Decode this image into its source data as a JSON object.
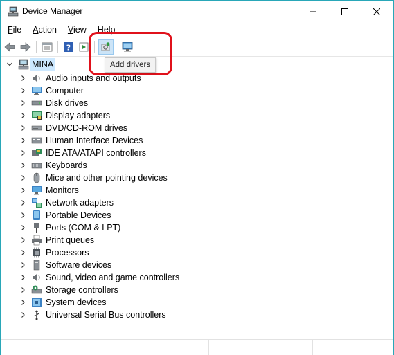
{
  "window": {
    "title": "Device Manager",
    "icon": "device-manager-icon",
    "accent": "#29a7b8"
  },
  "menu": [
    {
      "mnemonic": "F",
      "rest": "ile",
      "name": "menu-file"
    },
    {
      "mnemonic": "A",
      "rest": "ction",
      "name": "menu-action"
    },
    {
      "mnemonic": "V",
      "rest": "iew",
      "name": "menu-view"
    },
    {
      "mnemonic": "H",
      "rest": "elp",
      "name": "menu-help"
    }
  ],
  "toolbar": {
    "icons": [
      "back-arrow-icon",
      "forward-arrow-icon",
      "properties-icon",
      "help-icon",
      "run-icon",
      "add-drivers-icon",
      "scan-hardware-icon"
    ]
  },
  "tooltip": {
    "text": "Add drivers",
    "highlight_color": "#e0111b"
  },
  "tree": {
    "root": "MINA",
    "root_selected_color": "#cce8ff",
    "categories": [
      {
        "label": "Audio inputs and outputs",
        "icon": "speaker-icon"
      },
      {
        "label": "Computer",
        "icon": "computer-icon"
      },
      {
        "label": "Disk drives",
        "icon": "disk-drive-icon"
      },
      {
        "label": "Display adapters",
        "icon": "display-adapter-icon"
      },
      {
        "label": "DVD/CD-ROM drives",
        "icon": "dvd-drive-icon"
      },
      {
        "label": "Human Interface Devices",
        "icon": "hid-icon"
      },
      {
        "label": "IDE ATA/ATAPI controllers",
        "icon": "ide-controller-icon"
      },
      {
        "label": "Keyboards",
        "icon": "keyboard-icon"
      },
      {
        "label": "Mice and other pointing devices",
        "icon": "mouse-icon"
      },
      {
        "label": "Monitors",
        "icon": "monitor-icon"
      },
      {
        "label": "Network adapters",
        "icon": "network-adapter-icon"
      },
      {
        "label": "Portable Devices",
        "icon": "portable-device-icon"
      },
      {
        "label": "Ports (COM & LPT)",
        "icon": "port-icon"
      },
      {
        "label": "Print queues",
        "icon": "printer-icon"
      },
      {
        "label": "Processors",
        "icon": "processor-icon"
      },
      {
        "label": "Software devices",
        "icon": "software-device-icon"
      },
      {
        "label": "Sound, video and game controllers",
        "icon": "sound-controller-icon"
      },
      {
        "label": "Storage controllers",
        "icon": "storage-controller-icon"
      },
      {
        "label": "System devices",
        "icon": "system-device-icon"
      },
      {
        "label": "Universal Serial Bus controllers",
        "icon": "usb-icon"
      }
    ]
  }
}
